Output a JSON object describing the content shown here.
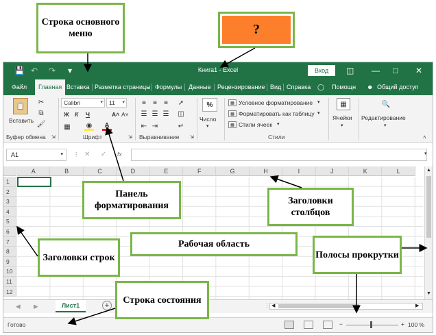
{
  "window": {
    "title": "Книга1 - Excel",
    "signin_label": "Вход",
    "accent_color": "#217346",
    "quick_access_icons": [
      "save-icon",
      "undo-icon",
      "redo-icon",
      "customize-icon"
    ],
    "window_controls": [
      "ribbon-display-icon",
      "minimize-icon",
      "maximize-icon",
      "close-icon"
    ]
  },
  "tabs": [
    {
      "label": "Файл"
    },
    {
      "label": "Главная",
      "active": true
    },
    {
      "label": "Вставка"
    },
    {
      "label": "Разметка страницы"
    },
    {
      "label": "Формулы"
    },
    {
      "label": "Данные"
    },
    {
      "label": "Рецензирование"
    },
    {
      "label": "Вид"
    },
    {
      "label": "Справка"
    },
    {
      "label": "Помощн"
    },
    {
      "label": "Общий доступ"
    }
  ],
  "ribbon": {
    "clipboard": {
      "paste_label": "Вставить",
      "group_label": "Буфер обмена"
    },
    "font": {
      "font_name": "Calibri",
      "font_size": "11",
      "group_label": "Шрифт",
      "bold": "Ж",
      "italic": "К",
      "underline": "Ч"
    },
    "alignment": {
      "group_label": "Выравнивание"
    },
    "number": {
      "label": "Число",
      "percent": "%"
    },
    "styles": {
      "conditional": "Условное форматирование",
      "as_table": "Форматировать как таблицу",
      "cell_styles": "Стили ячеек",
      "group_label": "Стили"
    },
    "cells": {
      "label": "Ячейки"
    },
    "editing": {
      "label": "Редактирование"
    }
  },
  "formula_bar": {
    "name_box": "A1",
    "fx": "fx",
    "value": ""
  },
  "grid": {
    "columns": [
      "A",
      "B",
      "C",
      "D",
      "E",
      "F",
      "G",
      "H",
      "I",
      "J",
      "K",
      "L"
    ],
    "rows": [
      "1",
      "2",
      "3",
      "4",
      "5",
      "6",
      "7",
      "8",
      "9",
      "10",
      "11",
      "12"
    ],
    "selected_cell": "A1"
  },
  "sheets": {
    "tabs": [
      "Лист1"
    ],
    "add_label": "+"
  },
  "status": {
    "text": "Готово",
    "zoom": "100 %"
  },
  "annotations": {
    "main_menu": "Строка основного меню",
    "question": "?",
    "format_panel": "Панель форматирования",
    "column_headers": "Заголовки столбцов",
    "row_headers": "Заголовки строк",
    "work_area": "Рабочая область",
    "scrollbars": "Полосы прокрутки",
    "status_bar": "Строка состояния",
    "callout_border_color": "#7ab648",
    "question_fill_color": "#fd7f2b"
  }
}
